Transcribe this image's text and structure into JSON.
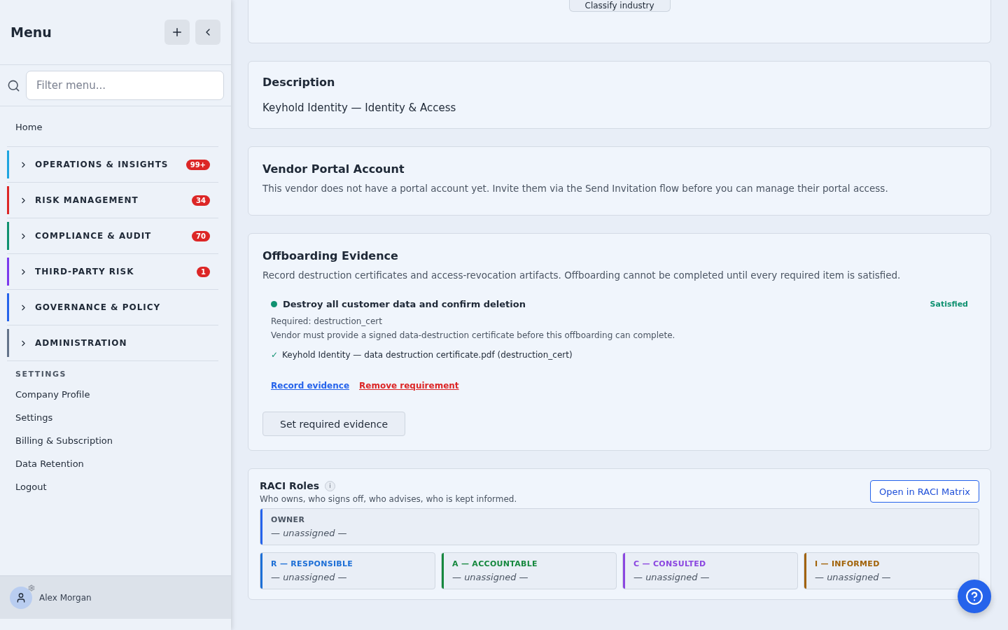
{
  "sidebar": {
    "title": "Menu",
    "filter": {
      "placeholder": "Filter menu..."
    },
    "home": "Home",
    "groups": [
      {
        "label": "OPERATIONS & INSIGHTS",
        "color": "#1ea5e0",
        "badge": "99+",
        "expanded": false
      },
      {
        "label": "RISK MANAGEMENT",
        "color": "#dc2626",
        "badge": "34",
        "expanded": false
      },
      {
        "label": "COMPLIANCE & AUDIT",
        "color": "#0f9170",
        "badge": "70",
        "expanded": false
      },
      {
        "label": "THIRD-PARTY RISK",
        "color": "#7c3aed",
        "badge": "1",
        "expanded": false
      },
      {
        "label": "GOVERNANCE & POLICY",
        "color": "#2563eb",
        "expanded": false
      },
      {
        "label": "ADMINISTRATION",
        "color": "#64748b",
        "expanded": false
      }
    ],
    "settings_heading": "SETTINGS",
    "settings_items": [
      "Company Profile",
      "Settings",
      "Billing & Subscription",
      "Data Retention",
      "Logout"
    ],
    "user": {
      "name": "Alex Morgan"
    }
  },
  "top_card": {
    "button": "Classify industry"
  },
  "description": {
    "title": "Description",
    "text": "Keyhold Identity — Identity & Access"
  },
  "portal": {
    "title": "Vendor Portal Account",
    "text": "This vendor does not have a portal account yet. Invite them via the Send Invitation flow before you can manage their portal access."
  },
  "offboarding": {
    "title": "Offboarding Evidence",
    "text": "Record destruction certificates and access-revocation artifacts. Offboarding cannot be completed until every required item is satisfied.",
    "items": [
      {
        "title": "Destroy all customer data and confirm deletion",
        "satisfied": true,
        "status": "Satisfied",
        "required": "Required: destruction_cert",
        "note": "Vendor must provide a signed data-destruction certificate before this offboarding can complete.",
        "evidence": [
          {
            "mark": "✓",
            "text": "Keyhold Identity — data destruction certificate.pdf (destruction_cert)"
          }
        ],
        "links": [
          {
            "label": "Record evidence",
            "kind": "normal"
          },
          {
            "label": "Remove requirement",
            "kind": "danger"
          }
        ]
      }
    ],
    "button": "Set required evidence"
  },
  "raci": {
    "title": "RACI Roles",
    "info": "i",
    "subtitle": "Who owns, who signs off, who advises, who is kept informed.",
    "button": "Open in RACI Matrix",
    "owner": {
      "label": "OWNER",
      "value": "— unassigned —",
      "color": "#2563eb"
    },
    "roles": [
      {
        "label": "R — RESPONSIBLE",
        "value": "— unassigned —",
        "color": "#1d6fd6"
      },
      {
        "label": "A — ACCOUNTABLE",
        "value": "— unassigned —",
        "color": "#16883e"
      },
      {
        "label": "C — CONSULTED",
        "value": "— unassigned —",
        "color": "#8b47e0"
      },
      {
        "label": "I — INFORMED",
        "value": "— unassigned —",
        "color": "#a16207"
      }
    ]
  }
}
